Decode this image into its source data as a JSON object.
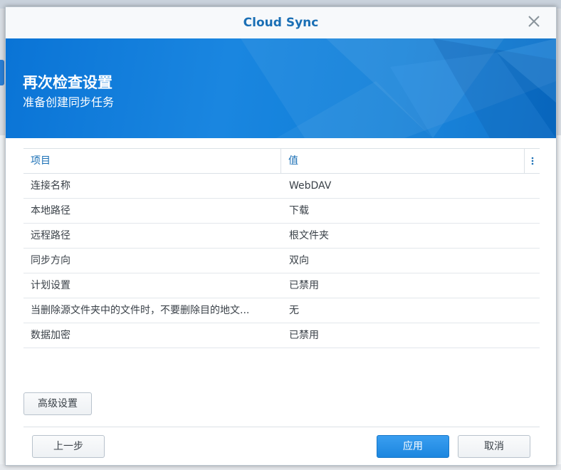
{
  "window": {
    "title": "Cloud Sync"
  },
  "banner": {
    "title": "再次检查设置",
    "subtitle": "准备创建同步任务"
  },
  "table": {
    "columns": [
      "项目",
      "值"
    ],
    "rows": [
      {
        "item": "连接名称",
        "value": "WebDAV"
      },
      {
        "item": "本地路径",
        "value": "下载"
      },
      {
        "item": "远程路径",
        "value": "根文件夹"
      },
      {
        "item": "同步方向",
        "value": "双向"
      },
      {
        "item": "计划设置",
        "value": "已禁用"
      },
      {
        "item": "当删除源文件夹中的文件时，不要删除目的地文...",
        "value": "无"
      },
      {
        "item": "数据加密",
        "value": "已禁用"
      }
    ]
  },
  "buttons": {
    "advanced": "高级设置",
    "prev": "上一步",
    "apply": "应用",
    "cancel": "取消"
  },
  "colors": {
    "accent": "#1a6fb5",
    "primary_button": "#2a8fe6",
    "banner": "#0a74d6"
  },
  "icons": {
    "close": "close-icon",
    "column_menu": "vertical-ellipsis-icon"
  }
}
